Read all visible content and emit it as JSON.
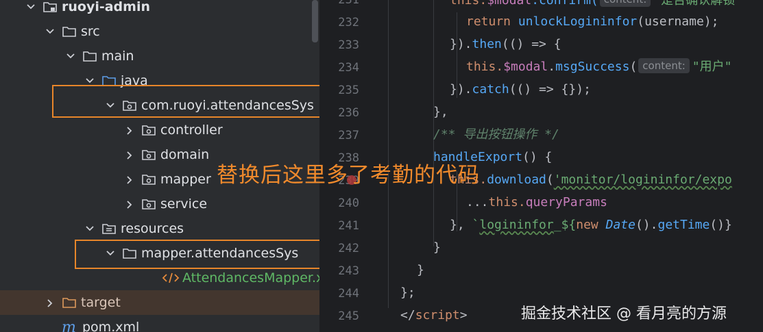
{
  "tree": {
    "rows": [
      {
        "label": "ruoyi-admin",
        "bold": true,
        "chevron": "down",
        "icon": "module-folder-icon"
      },
      {
        "label": "src",
        "chevron": "down",
        "icon": "folder-icon"
      },
      {
        "label": "main",
        "chevron": "down",
        "icon": "folder-icon"
      },
      {
        "label": "java",
        "chevron": "down",
        "icon": "source-folder-icon"
      },
      {
        "label": "com.ruoyi.attendancesSys",
        "chevron": "down",
        "icon": "package-icon"
      },
      {
        "label": "controller",
        "chevron": "right",
        "icon": "package-icon"
      },
      {
        "label": "domain",
        "chevron": "right",
        "icon": "package-icon"
      },
      {
        "label": "mapper",
        "chevron": "right",
        "icon": "package-icon"
      },
      {
        "label": "service",
        "chevron": "right",
        "icon": "package-icon"
      },
      {
        "label": "resources",
        "chevron": "down",
        "icon": "resources-folder-icon"
      },
      {
        "label": "mapper.attendancesSys",
        "chevron": "down",
        "icon": "folder-icon"
      },
      {
        "label": "AttendancesMapper.xml",
        "chevron": "none",
        "icon": "xml-file-icon",
        "style": "xml"
      },
      {
        "label": "target",
        "chevron": "right",
        "icon": "excluded-folder-icon",
        "style": "tgt",
        "selected": true
      },
      {
        "label": "pom.xml",
        "chevron": "none",
        "icon": "maven-icon"
      }
    ]
  },
  "editor": {
    "line_numbers": [
      "231",
      "232",
      "233",
      "234",
      "235",
      "236",
      "237",
      "238",
      "239",
      "240",
      "241",
      "242",
      "243",
      "244",
      "245"
    ],
    "code": {
      "l231_a": "this.",
      "l231_b": "$modal",
      "l231_c": ".confirm(",
      "l231_hint": "content:",
      "l231_str": "\"是否确认解锁",
      "l232_kw": "return ",
      "l232_fn": "unlockLogininfor",
      "l232_rest": "(username);",
      "l233_a": "}).",
      "l233_fn": "then",
      "l233_b": "(() => {",
      "l234_kw": "this.",
      "l234_pp": "$modal",
      "l234_dot": ".",
      "l234_fn": "msgSuccess",
      "l234_paren": "(",
      "l234_hint": "content:",
      "l234_str": "\"用户\"",
      "l235_a": "}).",
      "l235_fn": "catch",
      "l235_b": "(() => {});",
      "l236": "},",
      "l237": "/** 导出按钮操作 */",
      "l238_fn": "handleExport",
      "l238_b": "() {",
      "l239_kw": "this.",
      "l239_fn": "download",
      "l239_paren": "(",
      "l239_str": "'monitor/logininfor/expo",
      "l240_a": "...",
      "l240_kw": "this.",
      "l240_pp": "queryParams",
      "l241_a": "}, ",
      "l241_str1": "`",
      "l241_str2": "logininfor",
      "l241_str3": "_${",
      "l241_kw": "new ",
      "l241_it": "Date",
      "l241_b": "().",
      "l241_fn": "getTime",
      "l241_c": "()}",
      "l242": "}",
      "l243": "}",
      "l244": "};",
      "l245_a": "</",
      "l245_kw": "script",
      "l245_b": ">"
    }
  },
  "overlay": {
    "caption": "替换后这里多了考勤的代码",
    "watermark": "掘金技术社区 @ 看月亮的方源"
  },
  "colors": {
    "highlight_border": "#e8862a",
    "caption": "#f08a2c",
    "xml_file": "#5fb865",
    "selected_row": "#43362e"
  }
}
